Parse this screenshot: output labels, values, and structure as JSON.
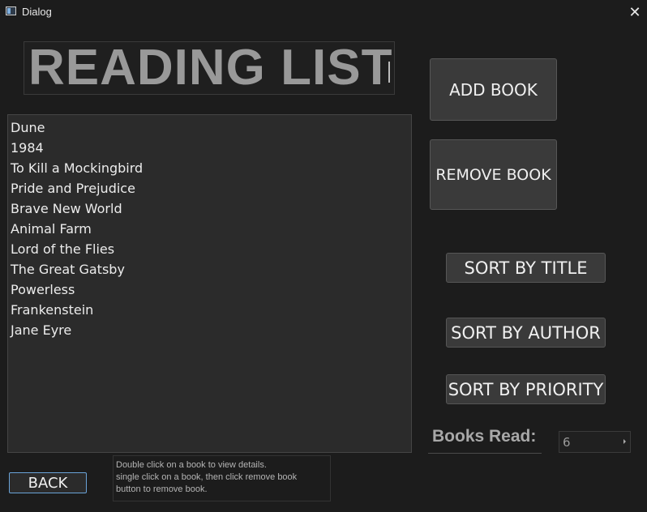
{
  "window": {
    "title": "Dialog"
  },
  "heading": "READING LIST",
  "books": [
    "Dune",
    "1984",
    "To Kill a Mockingbird",
    "Pride and Prejudice",
    "Brave New World",
    "Animal Farm",
    "Lord of the Flies",
    "The Great Gatsby",
    "Powerless",
    "Frankenstein",
    "Jane Eyre"
  ],
  "buttons": {
    "add": "ADD BOOK",
    "remove": "REMOVE BOOK",
    "sort_title": "SORT BY TITLE",
    "sort_author": "SORT BY AUTHOR",
    "sort_priority": "SORT BY PRIORITY",
    "back": "BACK"
  },
  "books_read": {
    "label": "Books Read:",
    "value": "6"
  },
  "hint": [
    "Double click on a book to view details.",
    "single click on a book, then click remove book",
    "button to remove book."
  ],
  "icons": {
    "close": "close-icon",
    "app": "app-icon",
    "spin": "spin-arrow-icon"
  },
  "colors": {
    "background": "#1c1c1c",
    "list_background": "#2b2b2b",
    "button": "#3a3a3a",
    "focus_border": "#6aa3d8"
  }
}
